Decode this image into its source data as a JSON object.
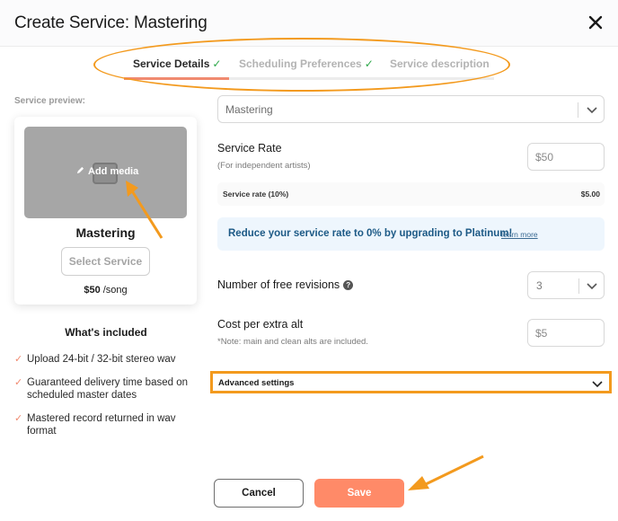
{
  "header": {
    "title": "Create Service: Mastering",
    "close_icon": "close-icon"
  },
  "tabs": [
    {
      "label": "Service Details",
      "completed": true,
      "active": true
    },
    {
      "label": "Scheduling Preferences",
      "completed": true,
      "active": false
    },
    {
      "label": "Service description",
      "completed": false,
      "active": false
    }
  ],
  "tab_check_glyph": "✓",
  "tab_progress_fraction": 0.33,
  "preview": {
    "label": "Service preview:",
    "add_media": "Add media",
    "service_name": "Mastering",
    "select_button": "Select Service",
    "price": "$50",
    "price_unit": "/song"
  },
  "included": {
    "title": "What's included",
    "items": [
      "Upload 24-bit / 32-bit stereo wav",
      "Guaranteed delivery time based on scheduled master dates",
      "Mastered record returned in wav format"
    ],
    "tick_glyph": "✓"
  },
  "form": {
    "service_type": "Mastering",
    "service_rate_label": "Service Rate",
    "service_rate_sub": "(For independent artists)",
    "service_rate_value": "$50",
    "fee_label": "Service rate (10%)",
    "fee_value": "$5.00",
    "promo_text": "Reduce your service rate to 0% by upgrading to Platinum!",
    "promo_link": "learn more",
    "revisions_label": "Number of free revisions",
    "revisions_help": "?",
    "revisions_value": "3",
    "extra_alt_label": "Cost per extra alt",
    "extra_alt_note": "*Note: main and clean alts are included.",
    "extra_alt_value": "$5",
    "advanced_label": "Advanced settings"
  },
  "footer": {
    "cancel": "Cancel",
    "save": "Save"
  },
  "colors": {
    "accent": "#ff8a68",
    "check_green": "#2ea84a",
    "annotation": "#f39a1e",
    "promo_text": "#1d5a86"
  }
}
